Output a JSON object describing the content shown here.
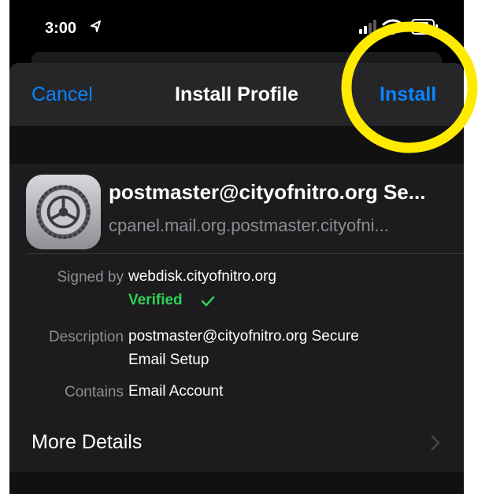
{
  "status_bar": {
    "time": "3:00"
  },
  "nav": {
    "cancel_label": "Cancel",
    "title": "Install Profile",
    "install_label": "Install"
  },
  "profile": {
    "name": "postmaster@cityofnitro.org Se...",
    "identifier": "cpanel.mail.org.postmaster.cityofni...",
    "icon": "settings-gear-icon"
  },
  "details": {
    "signed_by_label": "Signed by",
    "signed_by_value": "webdisk.cityofnitro.org",
    "verified_label": "Verified",
    "description_label": "Description",
    "description_line1": "postmaster@cityofnitro.org Secure",
    "description_line2": "Email Setup",
    "contains_label": "Contains",
    "contains_value": "Email Account"
  },
  "more_details_label": "More Details",
  "colors": {
    "accent": "#0a84ff",
    "verified": "#30d158",
    "highlight": "#ffeb00",
    "background": "#000000",
    "group_background": "#1c1c1e"
  }
}
